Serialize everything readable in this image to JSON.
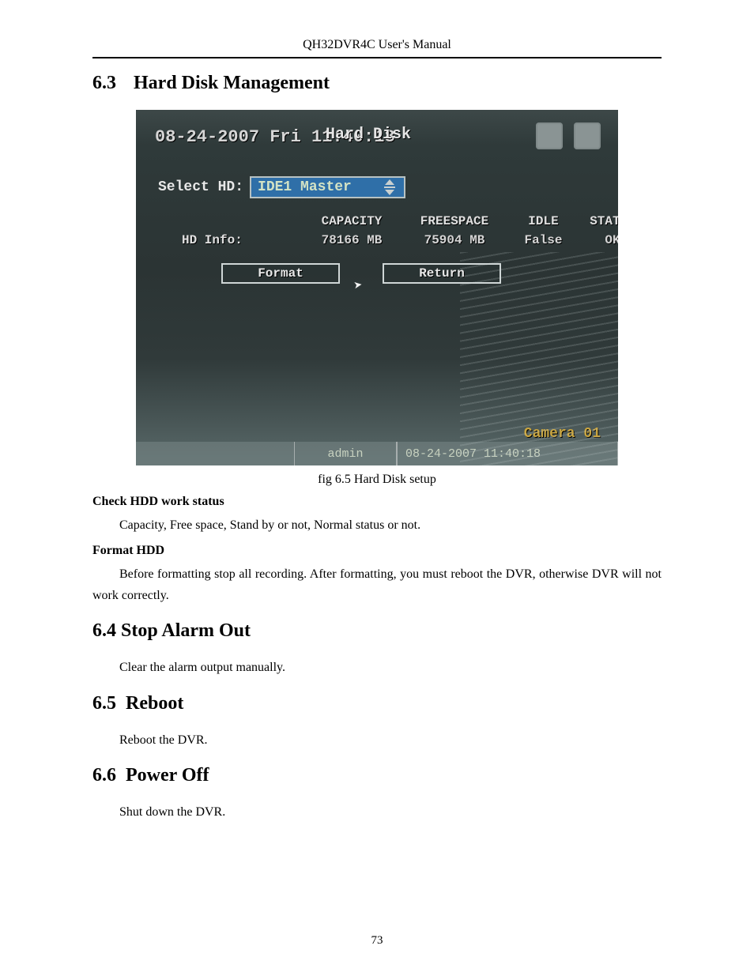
{
  "header": {
    "title": "QH32DVR4C User's Manual"
  },
  "section63": {
    "num": "6.3",
    "title": "Hard Disk Management"
  },
  "dvr": {
    "timestamp": "08-24-2007 Fri 11:40:18",
    "dialog_title": "Hard Disk",
    "select_label": "Select HD:",
    "select_value": "IDE1 Master",
    "columns": {
      "blank": "",
      "capacity": "CAPACITY",
      "freespace": "FREESPACE",
      "idle": "IDLE",
      "status": "STATUS"
    },
    "row": {
      "label": "HD Info:",
      "capacity": "78166 MB",
      "freespace": "75904 MB",
      "idle": "False",
      "status": "OK"
    },
    "buttons": {
      "format": "Format",
      "return": "Return"
    },
    "cam_label": "Camera 01",
    "status": {
      "user": "admin",
      "datetime": "08-24-2007 11:40:18"
    }
  },
  "caption63": "fig 6.5 Hard Disk setup",
  "sub_check": {
    "heading": "Check HDD work status",
    "text": "Capacity, Free space, Stand by or not, Normal status or not."
  },
  "sub_format": {
    "heading": "Format HDD",
    "text": "Before formatting stop all recording. After formatting, you must reboot the DVR, otherwise DVR will not work correctly."
  },
  "section64": {
    "num_title": "6.4 Stop Alarm Out",
    "text": "Clear the alarm output manually."
  },
  "section65": {
    "num": "6.5",
    "title": "Reboot",
    "text": "Reboot the DVR."
  },
  "section66": {
    "num": "6.6",
    "title": "Power Off",
    "text": "Shut down the DVR."
  },
  "pagenum": "73"
}
